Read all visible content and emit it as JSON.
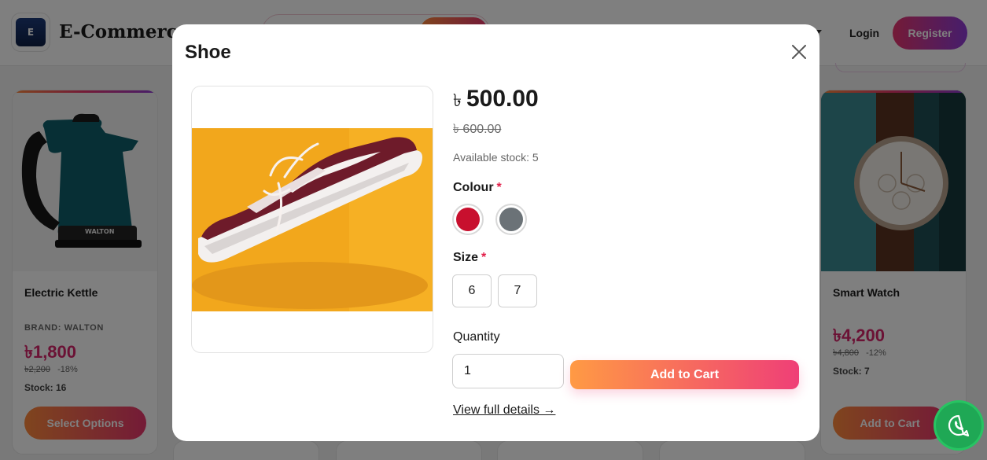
{
  "header": {
    "brand_name": "E-Commerce",
    "logo_letter": "E",
    "login_label": "Login",
    "register_label": "Register"
  },
  "products": [
    {
      "title": "Electric Kettle",
      "brand": "BRAND: WALTON",
      "price": "৳1,800",
      "old_price": "৳2,200",
      "discount": "-18%",
      "stock": "Stock: 16",
      "button_label": "Select Options",
      "image_text": "WALTON"
    },
    {
      "title": "Smart Watch",
      "price": "৳4,200",
      "old_price": "৳4,800",
      "discount": "-12%",
      "stock": "Stock: 7",
      "button_label": "Add to Cart"
    }
  ],
  "modal": {
    "title": "Shoe",
    "currency_symbol": "৳",
    "price": "500.00",
    "old_price": "৳ 600.00",
    "stock_text": "Available stock: 5",
    "colour_label": "Colour",
    "required_mark": "*",
    "colours": [
      {
        "name": "red",
        "hex": "#c8102e"
      },
      {
        "name": "grey",
        "hex": "#6b7277"
      }
    ],
    "size_label": "Size",
    "sizes": [
      "6",
      "7"
    ],
    "quantity_label": "Quantity",
    "quantity_value": "1",
    "add_to_cart_label": "Add to Cart",
    "full_details_label": "View full details →"
  },
  "icons": {
    "close": "close-icon",
    "whatsapp": "whatsapp-icon"
  },
  "colors": {
    "accent_pink": "#e8366e",
    "accent_orange": "#ff8a3c",
    "accent_purple": "#8d3bd8",
    "price_pink": "#d6246a",
    "required_red": "#e21d48",
    "whatsapp_green": "#1fa855"
  }
}
